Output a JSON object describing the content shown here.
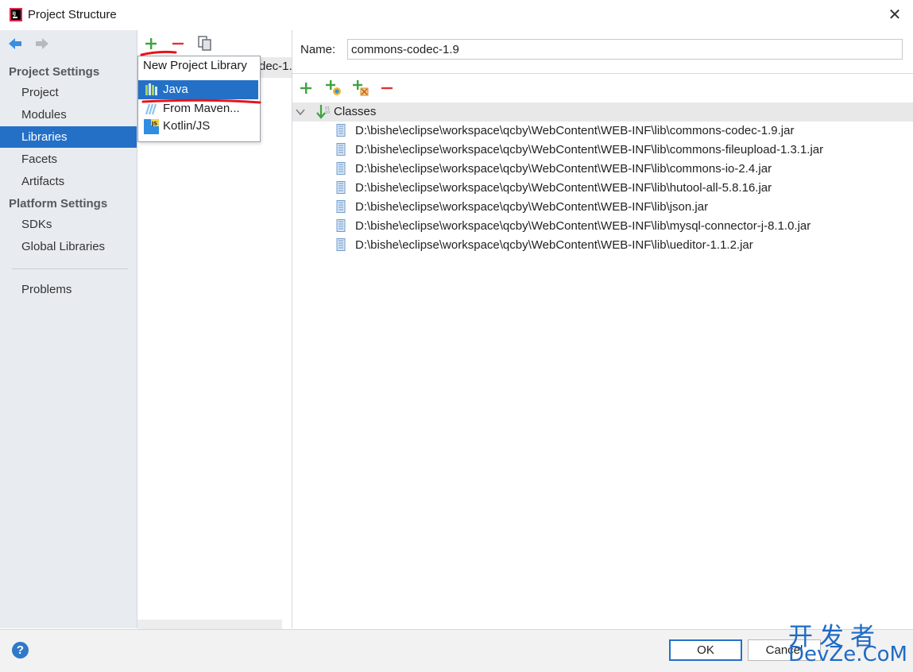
{
  "window": {
    "title": "Project Structure",
    "close_glyph": "✕"
  },
  "sidebar": {
    "project_settings_heading": "Project Settings",
    "project_items": [
      {
        "label": "Project"
      },
      {
        "label": "Modules"
      },
      {
        "label": "Libraries",
        "selected": true
      },
      {
        "label": "Facets"
      },
      {
        "label": "Artifacts"
      }
    ],
    "platform_settings_heading": "Platform Settings",
    "platform_items": [
      {
        "label": "SDKs"
      },
      {
        "label": "Global Libraries"
      }
    ],
    "problems_label": "Problems"
  },
  "toolbar_icons": [
    "back-arrow-icon",
    "forward-arrow-icon",
    "add-icon",
    "remove-icon",
    "copy-icon"
  ],
  "middle": {
    "library_row_text": "dec-1."
  },
  "popup": {
    "title": "New Project Library",
    "items": [
      {
        "label": "Java",
        "icon": "java-library-icon",
        "selected": true
      },
      {
        "label": "From Maven...",
        "icon": "maven-icon"
      },
      {
        "label": "Kotlin/JS",
        "icon": "kotlin-js-icon"
      }
    ]
  },
  "detail": {
    "name_label": "Name:",
    "name_value": "commons-codec-1.9",
    "classes_label": "Classes",
    "jars": [
      "D:\\bishe\\eclipse\\workspace\\qcby\\WebContent\\WEB-INF\\lib\\commons-codec-1.9.jar",
      "D:\\bishe\\eclipse\\workspace\\qcby\\WebContent\\WEB-INF\\lib\\commons-fileupload-1.3.1.jar",
      "D:\\bishe\\eclipse\\workspace\\qcby\\WebContent\\WEB-INF\\lib\\commons-io-2.4.jar",
      "D:\\bishe\\eclipse\\workspace\\qcby\\WebContent\\WEB-INF\\lib\\hutool-all-5.8.16.jar",
      "D:\\bishe\\eclipse\\workspace\\qcby\\WebContent\\WEB-INF\\lib\\json.jar",
      "D:\\bishe\\eclipse\\workspace\\qcby\\WebContent\\WEB-INF\\lib\\mysql-connector-j-8.1.0.jar",
      "D:\\bishe\\eclipse\\workspace\\qcby\\WebContent\\WEB-INF\\lib\\ueditor-1.1.2.jar"
    ]
  },
  "buttons": {
    "ok": "OK",
    "cancel": "Cancel",
    "help": "?"
  },
  "watermark": {
    "cn": "开发者",
    "en": "DevZe.CoM"
  },
  "colors": {
    "accent": "#2470c7",
    "annotation_red": "#e8141b",
    "add_green": "#3fa341"
  }
}
